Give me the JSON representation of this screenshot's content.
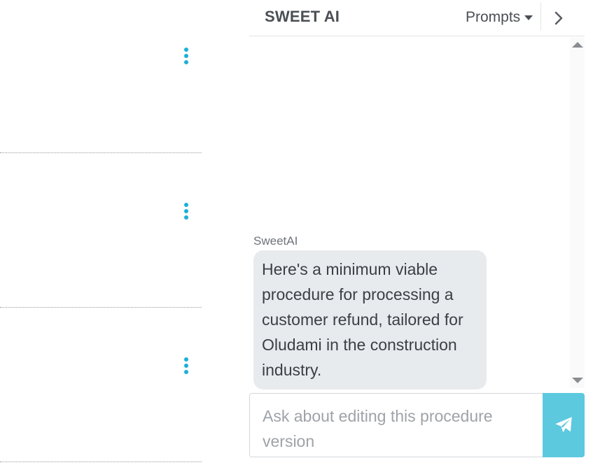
{
  "chat": {
    "title": "SWEET AI",
    "prompts_label": "Prompts",
    "messages": [
      {
        "sender": "SweetAI",
        "text": "Here's a minimum viable procedure for processing a customer refund, tailored for Oludami in the construction industry."
      }
    ],
    "input": {
      "value": "",
      "placeholder": "Ask about editing this procedure version"
    }
  },
  "icons": {
    "row_menu": "more-vertical-icon",
    "collapse": "chevron-right-icon",
    "prompts_caret": "caret-down-icon",
    "send": "paper-plane-icon",
    "scroll_up": "triangle-up-icon",
    "scroll_down": "triangle-down-icon"
  },
  "colors": {
    "accent": "#1ab0d6",
    "send_button": "#5cc9df",
    "bubble": "#e8ebee",
    "title_text": "#4a4f55"
  }
}
